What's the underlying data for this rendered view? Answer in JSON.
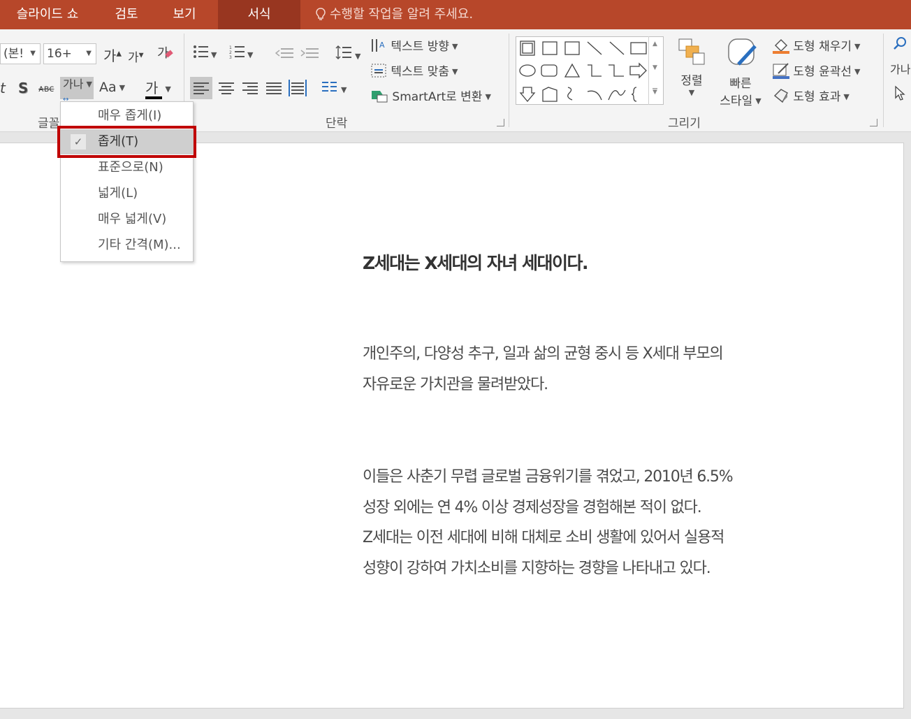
{
  "tabs": [
    {
      "label": "슬라이드 쇼",
      "active": false
    },
    {
      "label": "검토",
      "active": false
    },
    {
      "label": "보기",
      "active": false
    },
    {
      "label": "서식",
      "active": true
    }
  ],
  "tell_me": "수행할 작업을 알려 주세요.",
  "font_group": {
    "font_name": "(본!",
    "font_size": "16+",
    "grow_label": "가",
    "shrink_label": "가",
    "clear_label": "가",
    "italic_label": "t",
    "shadow_label": "S",
    "strike_label": "ᴀʙᴄ",
    "spacing_label": "가나",
    "case_label": "Aa",
    "color_label": "가",
    "group_label": "글꼴"
  },
  "paragraph_group": {
    "text_direction": "텍스트 방향",
    "text_align": "텍스트 맞춤",
    "smartart": "SmartArt로 변환",
    "group_label": "단락"
  },
  "drawing_group": {
    "arrange": "정렬",
    "quick_styles_line1": "빠른",
    "quick_styles_line2": "스타일",
    "shape_fill": "도형 채우기",
    "shape_outline": "도형 윤곽선",
    "shape_effects": "도형 효과",
    "group_label": "그리기"
  },
  "editing_group": {
    "replace_label": "가나"
  },
  "spacing_menu": {
    "items": [
      {
        "label": "매우 좁게(I)",
        "checked": false
      },
      {
        "label": "좁게(T)",
        "checked": true
      },
      {
        "label": "표준으로(N)",
        "checked": false
      },
      {
        "label": "넓게(L)",
        "checked": false
      },
      {
        "label": "매우 넓게(V)",
        "checked": false
      },
      {
        "label": "기타 간격(M)...",
        "checked": false
      }
    ],
    "check_mark": "✓"
  },
  "slide": {
    "title": "Z세대는 X세대의 자녀 세대이다.",
    "paragraph1": [
      "개인주의, 다양성 추구, 일과 삶의 균형 중시 등 X세대 부모의",
      "자유로운 가치관을 물려받았다."
    ],
    "paragraph2": [
      "이들은 사춘기 무렵 글로벌 금융위기를 겪었고, 2010년 6.5%",
      "성장 외에는 연 4% 이상 경제성장을 경험해본 적이 없다.",
      "Z세대는 이전 세대에 비해 대체로 소비 생활에 있어서 실용적",
      "성향이 강하여 가치소비를 지향하는 경향을 나타내고 있다."
    ]
  },
  "colors": {
    "tabbar": "#b7472a",
    "tab_active": "#983620",
    "highlight_border": "#c00000",
    "shape_fill_accent": "#ed7d31",
    "shape_outline_accent": "#4472c4"
  }
}
